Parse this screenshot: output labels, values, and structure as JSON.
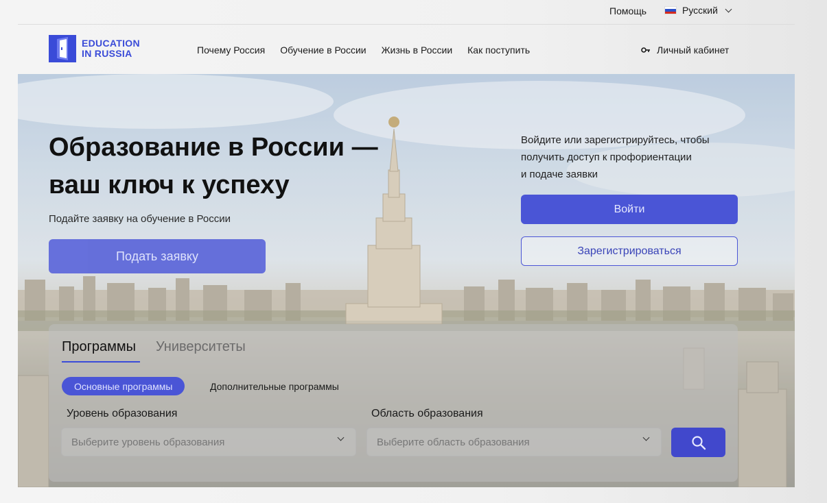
{
  "topbar": {
    "help": "Помощь",
    "language": "Русский"
  },
  "header": {
    "logo_line1": "EDUCATION",
    "logo_line2": "IN RUSSIA",
    "nav": [
      {
        "label": "Почему Россия"
      },
      {
        "label": "Обучение в России"
      },
      {
        "label": "Жизнь в России"
      },
      {
        "label": "Как поступить"
      }
    ],
    "cabinet": "Личный кабинет"
  },
  "hero": {
    "title_line1": "Образование в России —",
    "title_line2": "ваш ключ к успеху",
    "subtitle": "Подайте заявку на обучение в России",
    "apply_label": "Подать заявку",
    "login_text_line1": "Войдите или зарегистрируйтесь, чтобы",
    "login_text_line2": "получить доступ к профориентации",
    "login_text_line3": "и подаче заявки",
    "login_label": "Войти",
    "register_label": "Зарегистрироваться"
  },
  "search": {
    "tabs": [
      {
        "label": "Программы",
        "active": true
      },
      {
        "label": "Университеты",
        "active": false
      }
    ],
    "program_types": [
      {
        "label": "Основные программы",
        "active": true
      },
      {
        "label": "Дополнительные программы",
        "active": false
      }
    ],
    "level_label": "Уровень образования",
    "level_placeholder": "Выберите уровень образования",
    "area_label": "Область образования",
    "area_placeholder": "Выберите область образования"
  },
  "colors": {
    "accent": "#4a55d6",
    "logo": "#3a4bd8",
    "flag_white": "#ffffff",
    "flag_blue": "#2b4fc8",
    "flag_red": "#d52b1e"
  },
  "icons": {
    "language_flag": "russia-flag-icon",
    "dropdown": "chevron-down-icon",
    "cabinet": "key-icon",
    "search": "search-icon",
    "logo": "door-icon"
  }
}
